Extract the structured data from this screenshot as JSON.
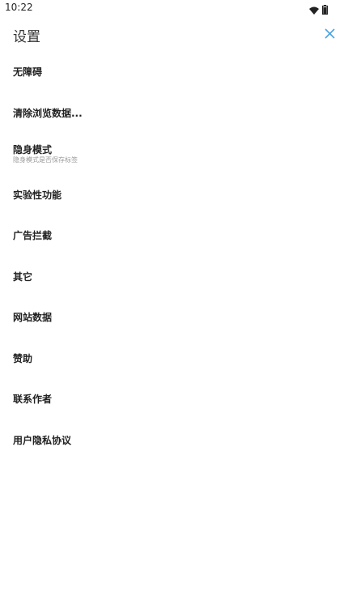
{
  "status_bar": {
    "time": "10:22",
    "icons": [
      "wifi-icon",
      "battery-icon"
    ]
  },
  "header": {
    "title": "设置",
    "close_icon": "close-icon",
    "accent_color": "#4da3e0"
  },
  "settings": {
    "items": [
      {
        "title": "无障碍"
      },
      {
        "title": "清除浏览数据..."
      },
      {
        "title": "隐身模式",
        "subtitle": "隐身模式是否保存标签"
      },
      {
        "title": "实验性功能"
      },
      {
        "title": "广告拦截"
      },
      {
        "title": "其它"
      },
      {
        "title": "网站数据"
      },
      {
        "title": "赞助"
      },
      {
        "title": "联系作者"
      },
      {
        "title": "用户隐私协议"
      }
    ]
  }
}
